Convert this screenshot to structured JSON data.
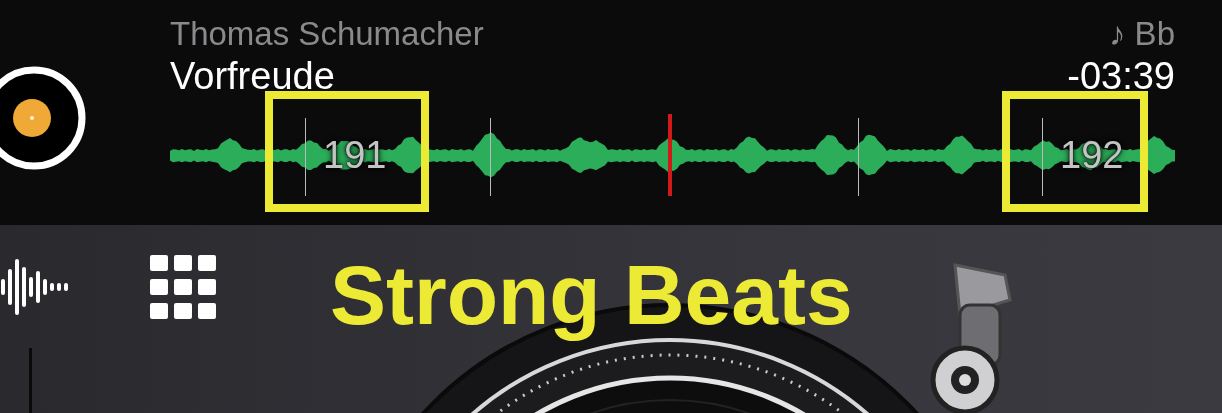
{
  "deck": {
    "artist": "Thomas Schumacher",
    "title": "Vorfreude",
    "key_symbol": "♪",
    "key": "Bb",
    "remaining_time": "-03:39",
    "beat_markers": [
      {
        "label": "191",
        "highlighted": true
      },
      {
        "label": "192",
        "highlighted": true
      }
    ]
  },
  "annotation": {
    "caption": "Strong Beats"
  }
}
